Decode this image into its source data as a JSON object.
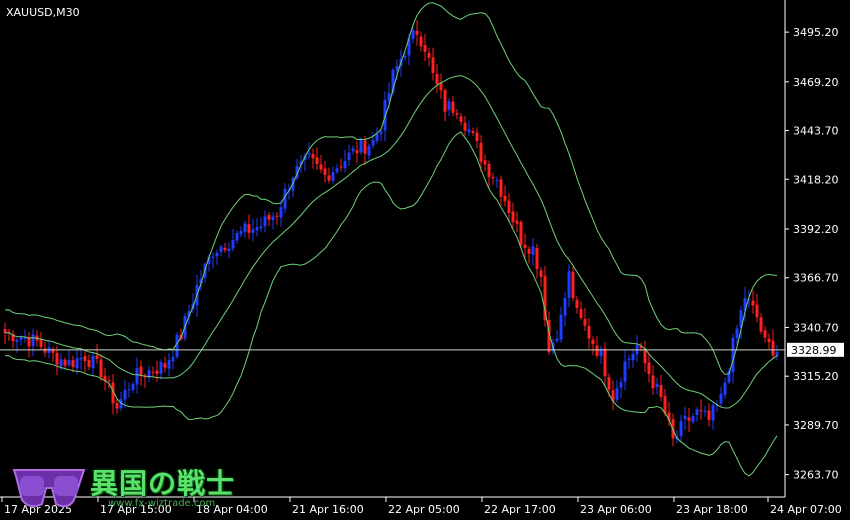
{
  "symbol_label": "XAUUSD,M30",
  "current_price_label": "3328.99",
  "colors": {
    "background": "#000000",
    "bull_candle": "#1f3cff",
    "bear_candle": "#ff2020",
    "upper_band_prefix": "#5fbf6a",
    "bands": "#6fd07a",
    "middle_band": "#6fd07a",
    "price_line": "#c8d8c8"
  },
  "watermark": {
    "title": "異国の戦士",
    "subtitle": "www.fx-wiztrade.com"
  },
  "chart_data": {
    "type": "candlestick",
    "title": "XAUUSD,M30",
    "ylim": [
      3252,
      3512
    ],
    "y_ticks": [
      3495.2,
      3469.2,
      3443.7,
      3418.2,
      3392.2,
      3366.7,
      3340.7,
      3315.2,
      3289.7,
      3263.7
    ],
    "y_tick_labels": [
      "3495.20",
      "3469.20",
      "3443.70",
      "3418.20",
      "3392.20",
      "3366.70",
      "3340.70",
      "3315.20",
      "3289.70",
      "3263.70"
    ],
    "x_tick_labels": [
      "17 Apr 2025",
      "17 Apr 15:00",
      "18 Apr 04:00",
      "21 Apr 16:00",
      "22 Apr 05:00",
      "22 Apr 17:00",
      "23 Apr 06:00",
      "23 Apr 18:00",
      "24 Apr 07:00"
    ],
    "x_tick_bar_index": [
      0,
      24,
      48,
      72,
      96,
      120,
      144,
      168,
      192
    ],
    "current_price": 3328.99,
    "close_anchors": [
      [
        0,
        3338
      ],
      [
        4,
        3336
      ],
      [
        8,
        3333
      ],
      [
        12,
        3326
      ],
      [
        16,
        3322
      ],
      [
        20,
        3326
      ],
      [
        24,
        3318
      ],
      [
        28,
        3299
      ],
      [
        32,
        3314
      ],
      [
        36,
        3318
      ],
      [
        40,
        3321
      ],
      [
        44,
        3337
      ],
      [
        48,
        3362
      ],
      [
        52,
        3381
      ],
      [
        56,
        3386
      ],
      [
        60,
        3391
      ],
      [
        64,
        3394
      ],
      [
        68,
        3401
      ],
      [
        72,
        3421
      ],
      [
        76,
        3428
      ],
      [
        80,
        3420
      ],
      [
        84,
        3427
      ],
      [
        88,
        3434
      ],
      [
        92,
        3438
      ],
      [
        94,
        3447
      ],
      [
        97,
        3472
      ],
      [
        100,
        3486
      ],
      [
        103,
        3496
      ],
      [
        105,
        3488
      ],
      [
        107,
        3472
      ],
      [
        110,
        3456
      ],
      [
        113,
        3456
      ],
      [
        116,
        3444
      ],
      [
        120,
        3426
      ],
      [
        123,
        3418
      ],
      [
        126,
        3403
      ],
      [
        129,
        3387
      ],
      [
        132,
        3382
      ],
      [
        134,
        3368
      ],
      [
        136,
        3328
      ],
      [
        139,
        3345
      ],
      [
        141,
        3368
      ],
      [
        143,
        3347
      ],
      [
        146,
        3337
      ],
      [
        149,
        3326
      ],
      [
        152,
        3305
      ],
      [
        155,
        3322
      ],
      [
        158,
        3331
      ],
      [
        161,
        3317
      ],
      [
        164,
        3303
      ],
      [
        167,
        3281
      ],
      [
        170,
        3291
      ],
      [
        173,
        3296
      ],
      [
        176,
        3292
      ],
      [
        179,
        3303
      ],
      [
        182,
        3331
      ],
      [
        185,
        3357
      ],
      [
        188,
        3346
      ],
      [
        190,
        3332
      ],
      [
        193,
        3329
      ]
    ],
    "band_period": 20,
    "band_deviation": 2
  }
}
